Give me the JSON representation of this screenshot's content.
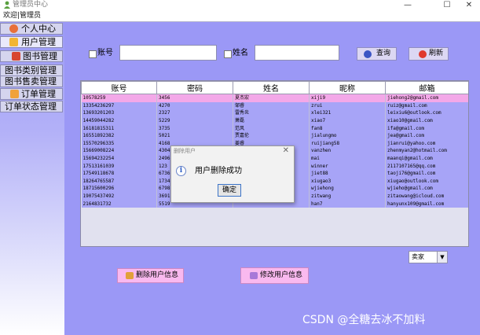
{
  "window": {
    "title": "管理员中心"
  },
  "menubar": {
    "welcome_text": "欢迎|管理员"
  },
  "sidebar": {
    "items": [
      {
        "label": "个人中心",
        "icon": "person-icon",
        "active": false
      },
      {
        "label": "用户管理",
        "icon": "folder-icon",
        "active": true
      },
      {
        "label": "图书管理",
        "icon": "book-icon",
        "active": false
      },
      {
        "label": "图书类别管理",
        "icon": "",
        "active": false
      },
      {
        "label": "图书售卖管理",
        "icon": "",
        "active": false
      },
      {
        "label": "订单管理",
        "icon": "order-icon",
        "active": false
      },
      {
        "label": "订单状态管理",
        "icon": "",
        "active": false
      }
    ]
  },
  "search": {
    "account_label": "账号",
    "account_value": "",
    "name_label": "姓名",
    "name_value": "",
    "query_label": "查询",
    "refresh_label": "刷新"
  },
  "table": {
    "columns": [
      "账号",
      "密码",
      "姓名",
      "昵称",
      "邮箱"
    ],
    "rows": [
      [
        "10578259",
        "3456",
        "夏杰宏",
        "xiji9",
        "jiehong2@gmail.com"
      ],
      [
        "13354236297",
        "4270",
        "邹睿",
        "zrui",
        "ruiz@gmail.com"
      ],
      [
        "13693201203",
        "2327",
        "雷秀炎",
        "xlei321",
        "leixiu6@outlook.com"
      ],
      [
        "14459044282",
        "5229",
        "萧磊",
        "xiao7",
        "xiao10@gmail.com"
      ],
      [
        "16181815311",
        "3735",
        "范风",
        "fan8",
        "ifa@gmail.com"
      ],
      [
        "16551892382",
        "5021",
        "贾嘉伦",
        "jialungmo",
        "jea@gmail.com"
      ],
      [
        "15570296335",
        "4168",
        "姜睿",
        "ruijiang58",
        "jianrui@yahoo.com"
      ],
      [
        "15669008224",
        "4304",
        "",
        "vanzhen",
        "zhenmyan2@hotmail.com"
      ],
      [
        "15694232254",
        "2496",
        "",
        "mai",
        "maanqi@gmail.com"
      ],
      [
        "17513161039",
        "123",
        "",
        "winner",
        "2117107165@qq.com"
      ],
      [
        "17549118678",
        "6736",
        "",
        "jiet88",
        "taoji76@gmail.com"
      ],
      [
        "18264765587",
        "1734",
        "",
        "xiugao3",
        "xiugao@outlook.com"
      ],
      [
        "18715600296",
        "6798",
        "",
        "wjiehong",
        "wjieho@gmail.com"
      ],
      [
        "19075437492",
        "3691",
        "",
        "zitwang",
        "zitaowang@icloud.com"
      ],
      [
        "2164831732",
        "5519",
        "",
        "han7",
        "hanyunx109@gmail.com"
      ]
    ],
    "selected_row": 0
  },
  "filter": {
    "selected": "卖家"
  },
  "actions": {
    "delete_label": "删除用户信息",
    "edit_label": "修改用户信息"
  },
  "dialog": {
    "title": "删除用户",
    "message": "用户删除成功",
    "ok_label": "确定",
    "icon": "info-icon"
  },
  "watermark": "CSDN @全糖去冰不加料",
  "colors": {
    "background": "#9b98f6",
    "table_row": "#a7a4f7",
    "selected_row": "#f3a8e8",
    "pink_button": "#f9b9ef"
  }
}
